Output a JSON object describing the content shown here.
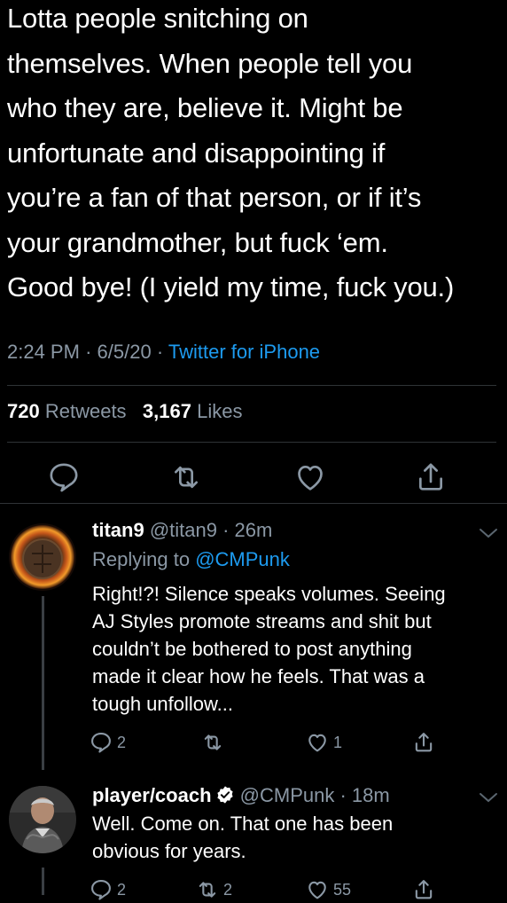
{
  "tweet": {
    "lines": [
      "Lotta people snitching on",
      "themselves. When people tell you",
      "who they are, believe it. Might be",
      "unfortunate and disappointing if",
      "you’re a fan of that person, or if it’s",
      "your grandmother, but fuck ‘em.",
      "Good bye! (I yield my time, fuck you.)"
    ],
    "time": "2:24 PM",
    "date": "6/5/20",
    "source": "Twitter for iPhone",
    "retweets_count": "720",
    "retweets_label": "Retweets",
    "likes_count": "3,167",
    "likes_label": "Likes"
  },
  "replies": [
    {
      "name": "titan9",
      "handle": "@titan9",
      "time": "26m",
      "replying_label": "Replying to",
      "replying_handle": "@CMPunk",
      "lines": [
        "Right!?! Silence speaks volumes. Seeing",
        "AJ Styles promote streams and shit but",
        "couldn’t be bothered to post anything",
        "made it clear how he feels. That was a",
        "tough unfollow..."
      ],
      "reply_count": "2",
      "retweet_count": "",
      "like_count": "1"
    },
    {
      "name": "player/coach",
      "handle": "@CMPunk",
      "time": "18m",
      "lines": [
        "Well. Come on. That one has been",
        "obvious for years."
      ],
      "reply_count": "2",
      "retweet_count": "2",
      "like_count": "55"
    }
  ],
  "colors": {
    "background": "#000000",
    "secondary_text": "#8b98a5",
    "link": "#1d9bf0",
    "divider": "#2f3336"
  },
  "icons": [
    "reply-icon",
    "retweet-icon",
    "like-icon",
    "share-icon",
    "chevron-down-icon",
    "verified-badge-icon"
  ]
}
